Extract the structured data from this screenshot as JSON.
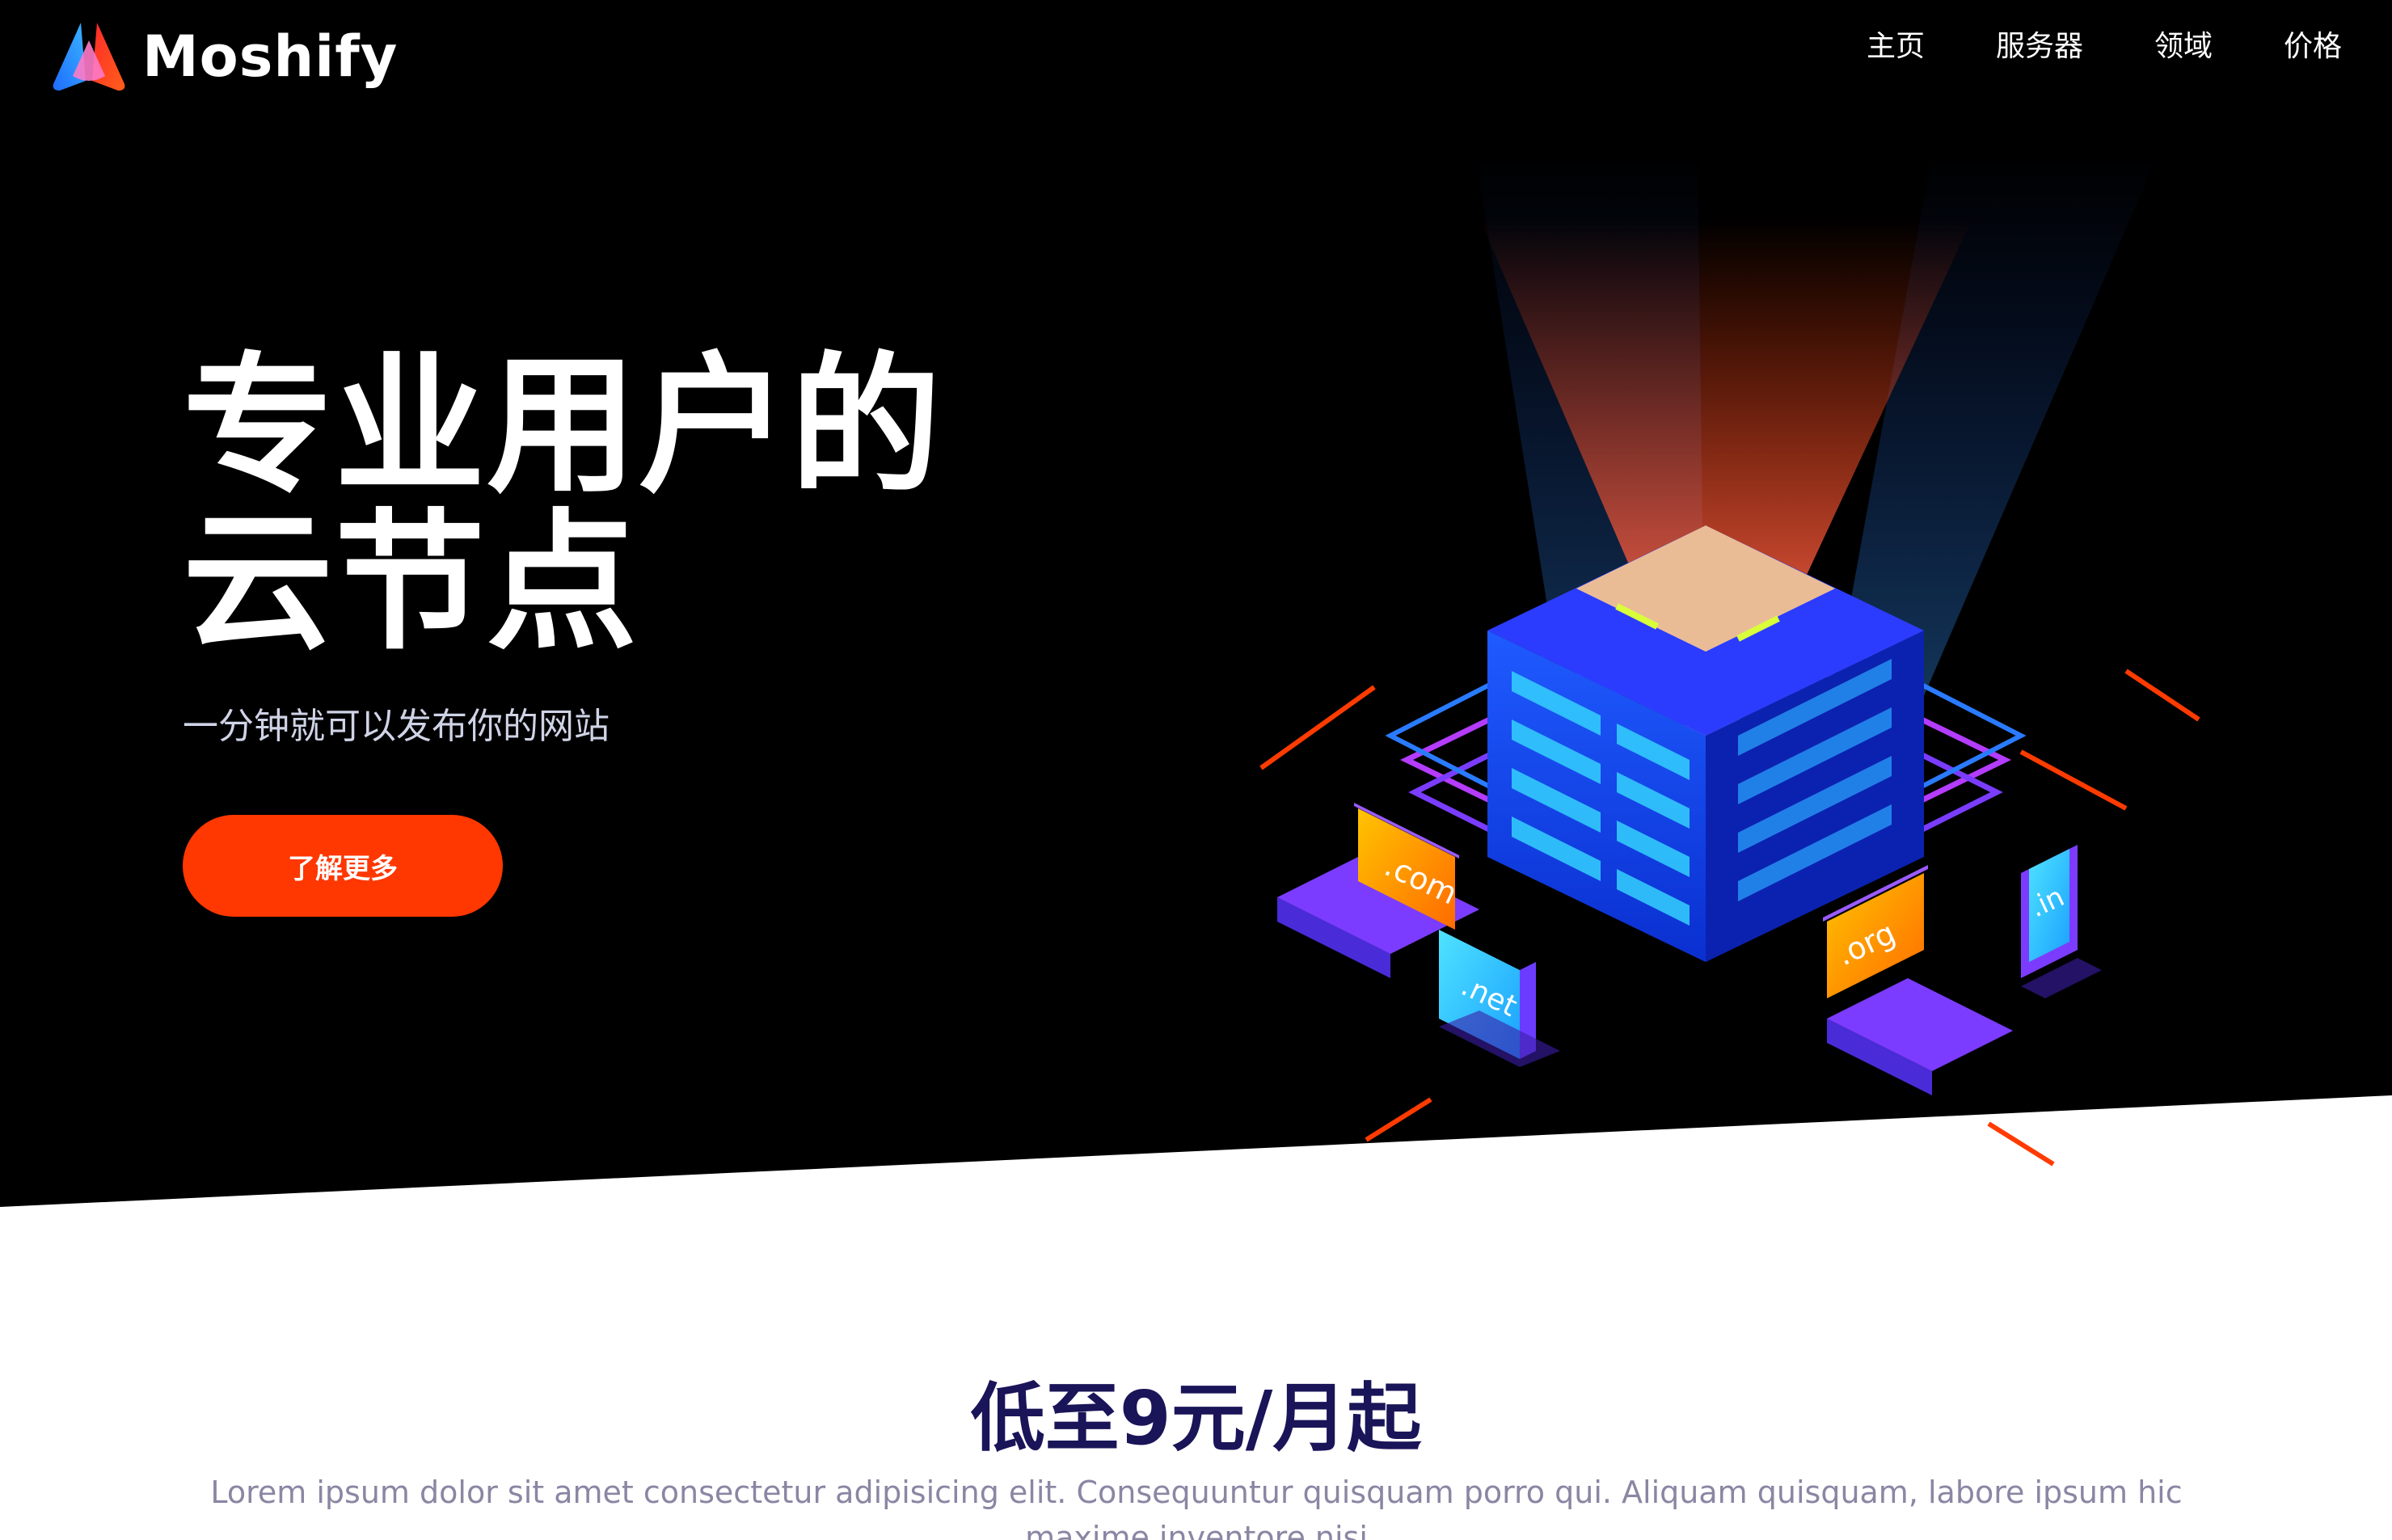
{
  "brand": {
    "name": "Moshify",
    "colors": {
      "accent": "#ff3700",
      "hero_bg": "#000000",
      "heading": "#1a1458",
      "muted": "#8a86a3"
    }
  },
  "nav": {
    "items": [
      {
        "label": "主页"
      },
      {
        "label": "服务器"
      },
      {
        "label": "领域"
      },
      {
        "label": "价格"
      }
    ]
  },
  "hero": {
    "title_line1": "专业用户的",
    "title_line2": "云节点",
    "subtitle": "一分钟就可以发布你的网站",
    "cta_label": "了解更多",
    "illustration": {
      "icon": "server-network-illustration",
      "domains": [
        ".com",
        ".net",
        ".org",
        ".in"
      ]
    }
  },
  "pricing": {
    "title": "低至9元/月起",
    "description": "Lorem ipsum dolor sit amet consectetur adipisicing elit. Consequuntur quisquam porro qui. Aliquam quisquam, labore ipsum hic maxime inventore nisi"
  }
}
